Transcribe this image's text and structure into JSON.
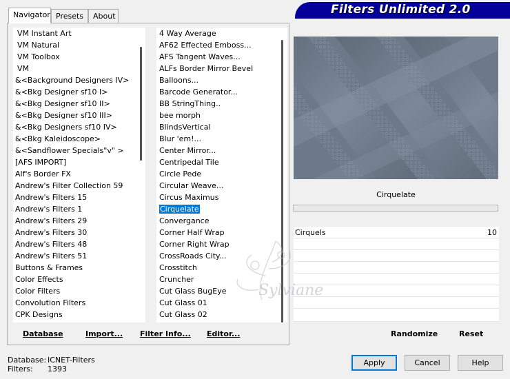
{
  "banner": {
    "title": "Filters Unlimited 2.0"
  },
  "tabs": [
    {
      "label": "Navigator"
    },
    {
      "label": "Presets"
    },
    {
      "label": "About"
    }
  ],
  "categories": [
    "VM Instant Art",
    "VM Natural",
    "VM Toolbox",
    "VM",
    "&<Background Designers IV>",
    "&<Bkg Designer sf10 I>",
    "&<Bkg Designer sf10 II>",
    "&<Bkg Designer sf10 III>",
    "&<Bkg Designers sf10 IV>",
    "&<Bkg Kaleidoscope>",
    "&<Sandflower Specials\"v\" >",
    "[AFS IMPORT]",
    "Alf's Border FX",
    "Andrew's Filter Collection 59",
    "Andrew's Filters 15",
    "Andrew's Filters 1",
    "Andrew's Filters 29",
    "Andrew's Filters 30",
    "Andrew's Filters 48",
    "Andrew's Filters 51",
    "Buttons & Frames",
    "Color Effects",
    "Color Filters",
    "Convolution Filters",
    "CPK Designs"
  ],
  "filters": [
    "4 Way Average",
    "AF62 Effected Emboss...",
    "AFS Tangent Waves...",
    "ALFs Border Mirror Bevel",
    "Balloons...",
    "Barcode Generator...",
    "BB StringThing..",
    "bee morph",
    "BlindsVertical",
    "Blur 'em!...",
    "Center Mirror...",
    "Centripedal Tile",
    "Circle Pede",
    "Circular Weave...",
    "Circus Maximus",
    "Cirquelate",
    "Convergance",
    "Corner Half Wrap",
    "Corner Right Wrap",
    "CrossRoads City...",
    "Crosstitch",
    "Cruncher",
    "Cut Glass  BugEye",
    "Cut Glass 01",
    "Cut Glass 02"
  ],
  "selected_filter_index": 15,
  "toolbar": {
    "database": "Database",
    "import": "Import...",
    "filter_info": "Filter Info...",
    "editor": "Editor...",
    "randomize": "Randomize",
    "reset": "Reset"
  },
  "preview": {
    "filter_name": "Cirquelate",
    "params": [
      {
        "label": "Cirquels",
        "value": "10"
      }
    ]
  },
  "footer": {
    "database_label": "Database:",
    "database_value": "ICNET-Filters",
    "filters_label": "Filters:",
    "filters_value": "1393",
    "apply": "Apply",
    "cancel": "Cancel",
    "help": "Help"
  },
  "watermark": {
    "text": "Sylviane"
  }
}
